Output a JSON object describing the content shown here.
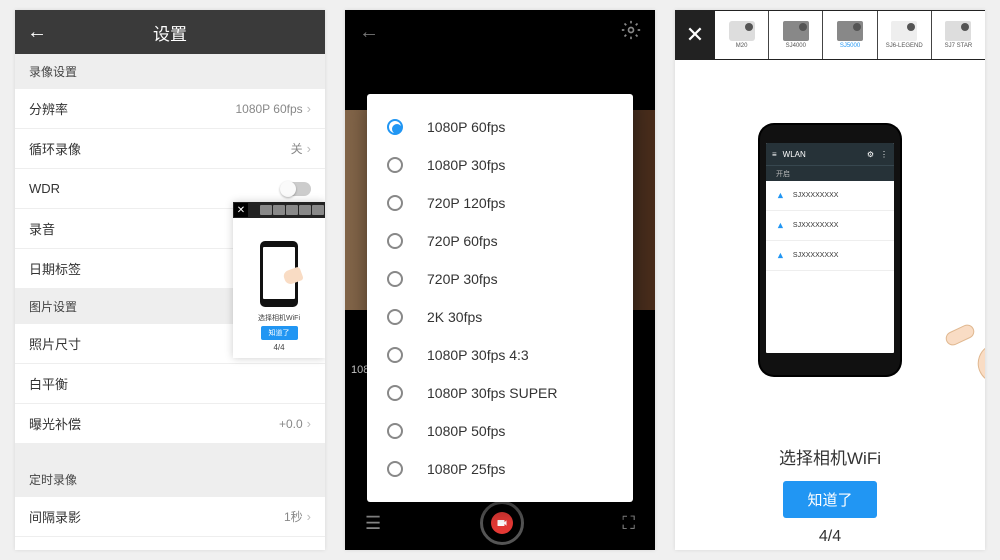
{
  "s1": {
    "title": "设置",
    "sec_video": "录像设置",
    "rows": {
      "resolution": {
        "label": "分辨率",
        "value": "1080P 60fps"
      },
      "loop": {
        "label": "循环录像",
        "value": "关"
      },
      "wdr": {
        "label": "WDR"
      },
      "audio": {
        "label": "录音"
      },
      "datestamp": {
        "label": "日期标签"
      }
    },
    "sec_photo": "图片设置",
    "rows2": {
      "photosize": {
        "label": "照片尺寸"
      },
      "wb": {
        "label": "白平衡"
      },
      "ev": {
        "label": "曝光补偿",
        "value": "+0.0"
      }
    },
    "sec_timer": "定时录像",
    "rows3": {
      "timelapse": {
        "label": "间隔录影",
        "value": "1秒"
      }
    },
    "popup": {
      "caption": "选择相机WiFi",
      "btn": "知道了",
      "page": "4/4"
    }
  },
  "s2": {
    "options": [
      "1080P 60fps",
      "1080P 30fps",
      "720P 120fps",
      "720P 60fps",
      "720P 30fps",
      "2K 30fps",
      "1080P 30fps 4:3",
      "1080P 30fps SUPER",
      "1080P 50fps",
      "1080P 25fps"
    ],
    "selected": 0,
    "leftnum": "108"
  },
  "s3": {
    "models": [
      "M20",
      "SJ4000",
      "SJ5000",
      "SJ6-LEGEND",
      "SJ7 STAR"
    ],
    "active_model": 2,
    "wlan": {
      "title": "WLAN",
      "sub": "开启",
      "items": [
        "SJXXXXXXXX",
        "SJXXXXXXXX",
        "SJXXXXXXXX"
      ]
    },
    "caption": "选择相机WiFi",
    "btn": "知道了",
    "page": "4/4"
  }
}
